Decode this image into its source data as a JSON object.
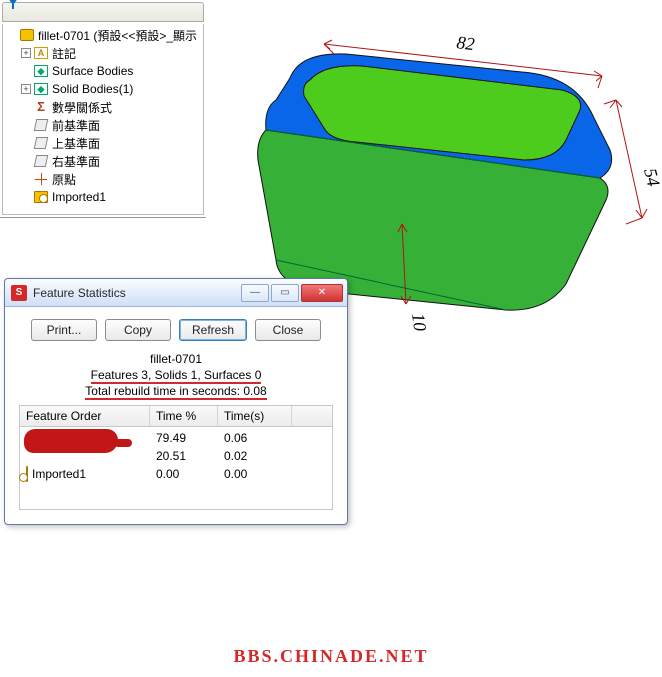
{
  "tree": {
    "root": "fillet-0701 (預設<<預設>_顯示",
    "items": [
      {
        "label": "註記",
        "icon": "folder-a",
        "expandable": true,
        "plus": "+"
      },
      {
        "label": "Surface Bodies",
        "icon": "folder-s",
        "expandable": false
      },
      {
        "label": "Solid Bodies(1)",
        "icon": "folder-s",
        "expandable": true,
        "plus": "+"
      },
      {
        "label": "數學關係式",
        "icon": "sigma",
        "expandable": false
      },
      {
        "label": "前基準面",
        "icon": "plane",
        "expandable": false
      },
      {
        "label": "上基準面",
        "icon": "plane",
        "expandable": false
      },
      {
        "label": "右基準面",
        "icon": "plane",
        "expandable": false
      },
      {
        "label": "原點",
        "icon": "origin",
        "expandable": false
      },
      {
        "label": "Imported1",
        "icon": "imported",
        "expandable": false
      }
    ]
  },
  "dimensions": {
    "length": "82",
    "width": "54",
    "height": "10"
  },
  "dialog": {
    "title": "Feature Statistics",
    "buttons": {
      "print": "Print...",
      "copy": "Copy",
      "refresh": "Refresh",
      "close": "Close"
    },
    "info_name": "fillet-0701",
    "info_summary": "Features 3, Solids 1, Surfaces 0",
    "info_rebuild": "Total rebuild time in seconds: 0.08",
    "columns": {
      "order": "Feature Order",
      "pct": "Time %",
      "secs": "Time(s)"
    },
    "rows": [
      {
        "name": "",
        "pct": "79.49",
        "secs": "0.06",
        "redacted": true
      },
      {
        "name": "",
        "pct": "20.51",
        "secs": "0.02",
        "redacted": true
      },
      {
        "name": "Imported1",
        "pct": "0.00",
        "secs": "0.00",
        "icon": "imported"
      }
    ]
  },
  "watermark": "BBS.CHINADE.NET"
}
